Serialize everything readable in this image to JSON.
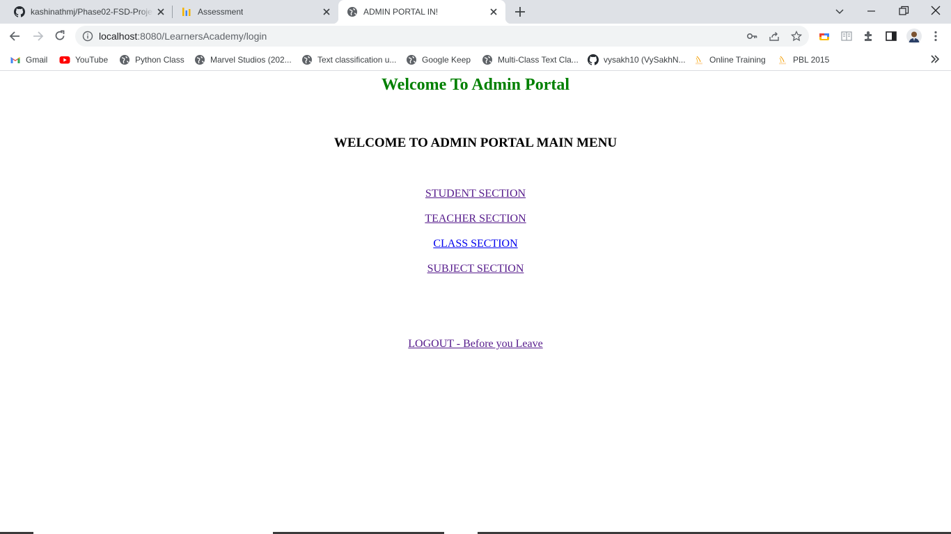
{
  "browser": {
    "tabs": [
      {
        "title": "kashinathmj/Phase02-FSD-Project",
        "favicon": "github-icon"
      },
      {
        "title": "Assessment",
        "favicon": "bar-chart-icon"
      },
      {
        "title": "ADMIN PORTAL IN!",
        "favicon": "globe-icon",
        "active": true
      }
    ],
    "address": {
      "host": "localhost",
      "path": ":8080/LearnersAcademy/login"
    },
    "bookmarks": [
      {
        "label": "Gmail",
        "icon": "gmail-icon"
      },
      {
        "label": "YouTube",
        "icon": "youtube-icon"
      },
      {
        "label": "Python Class",
        "icon": "globe-icon"
      },
      {
        "label": "Marvel Studios (202...",
        "icon": "globe-icon"
      },
      {
        "label": "Text classification u...",
        "icon": "globe-icon"
      },
      {
        "label": "Google Keep",
        "icon": "globe-icon"
      },
      {
        "label": "Multi-Class Text Cla...",
        "icon": "globe-icon"
      },
      {
        "label": "vysakh10 (VySakhN...",
        "icon": "github-icon"
      },
      {
        "label": "Online Training",
        "icon": "pbl-icon"
      },
      {
        "label": "PBL 2015",
        "icon": "pbl-icon"
      }
    ],
    "colors": {
      "tabstrip": "#dee1e6",
      "omnibox": "#f1f3f4"
    }
  },
  "page": {
    "title": "Welcome To Admin Portal",
    "heading": "WELCOME TO ADMIN PORTAL MAIN MENU",
    "links": {
      "student": "STUDENT SECTION",
      "teacher": "TEACHER SECTION",
      "class": "CLASS SECTION",
      "subject": "SUBJECT SECTION",
      "logout": "LOGOUT - Before you Leave"
    },
    "colors": {
      "title": "#008000",
      "visited_link": "#551a8b",
      "link": "#0000ee"
    }
  }
}
